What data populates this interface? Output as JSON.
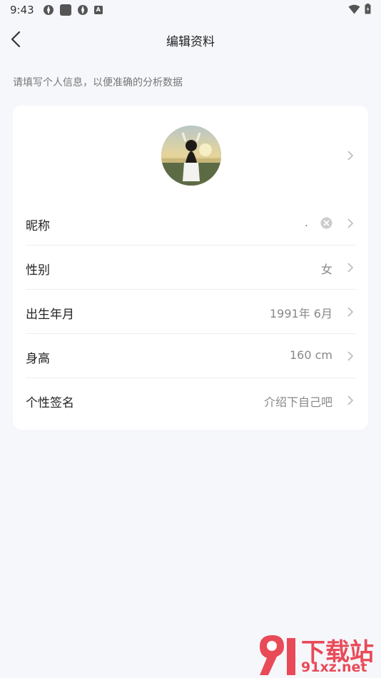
{
  "status_bar": {
    "time": "9:43"
  },
  "nav": {
    "title": "编辑资料"
  },
  "hint": "请填写个人信息，以便准确的分析数据",
  "profile": {
    "rows": [
      {
        "label": "昵称",
        "value": "."
      },
      {
        "label": "性别",
        "value": "女"
      },
      {
        "label": "出生年月",
        "value": "1991年 6月"
      },
      {
        "label": "身高",
        "value": "160 cm"
      },
      {
        "label": "个性签名",
        "value": "介绍下自己吧"
      }
    ]
  },
  "watermark": {
    "top": "下载站",
    "bottom": "91xz.net"
  }
}
